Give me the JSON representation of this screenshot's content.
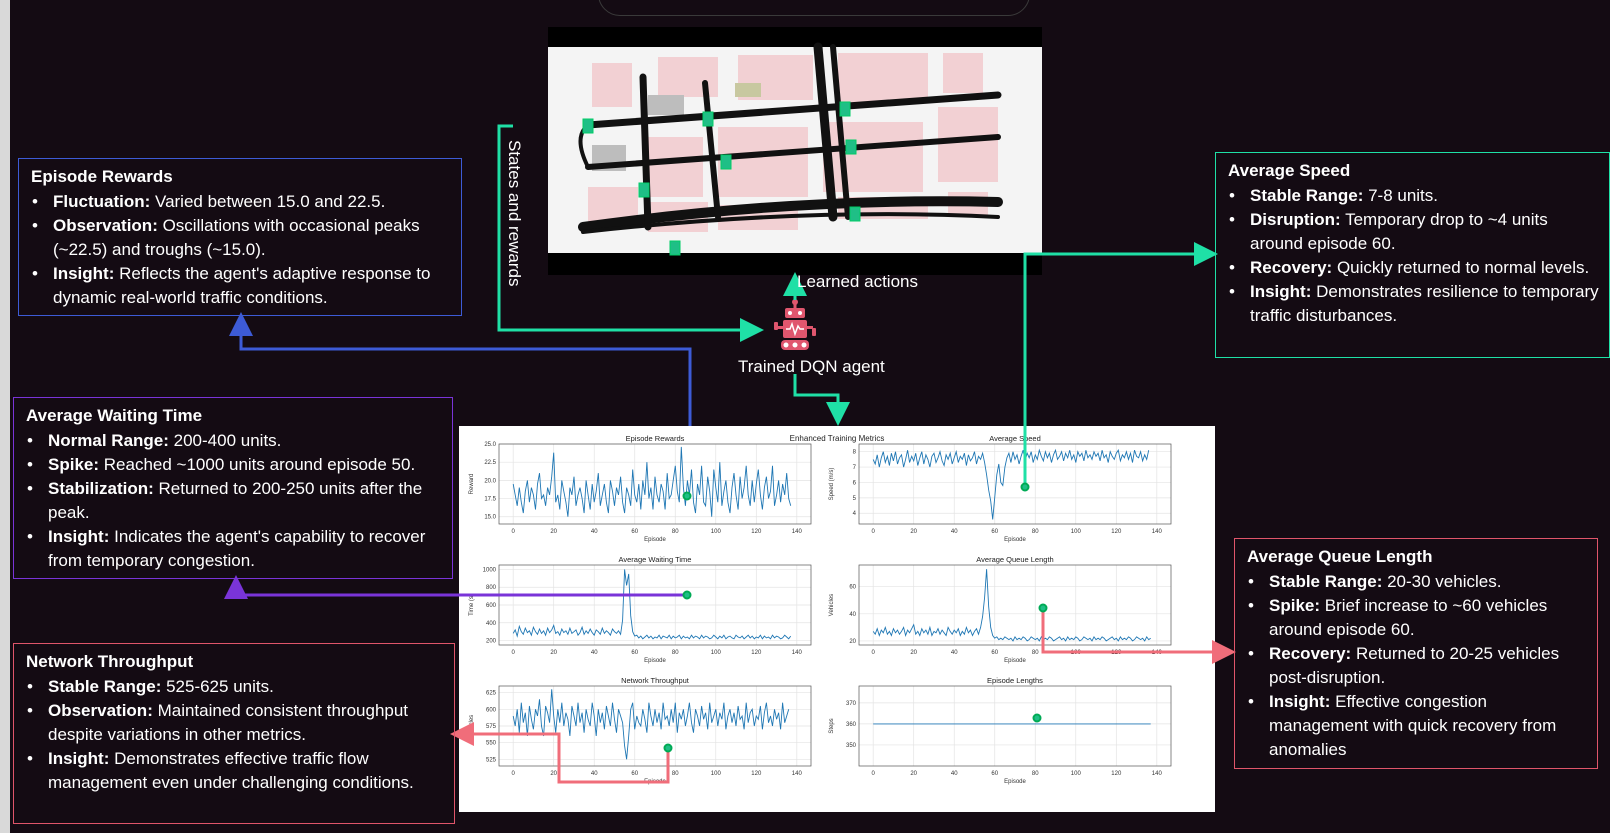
{
  "labels": {
    "states_rewards": "States and rewards",
    "learned_actions": "Learned  actions",
    "agent": "Trained  DQN agent"
  },
  "boxes": {
    "episode_rewards": {
      "title": "Episode Rewards",
      "items": [
        {
          "key": "Fluctuation:",
          "text": " Varied between 15.0 and 22.5."
        },
        {
          "key": "Observation:",
          "text": " Oscillations with occasional peaks (~22.5) and troughs (~15.0)."
        },
        {
          "key": "Insight:",
          "text": " Reflects the agent's adaptive response to dynamic real-world traffic conditions."
        }
      ]
    },
    "average_waiting_time": {
      "title": "Average Waiting Time",
      "items": [
        {
          "key": "Normal Range:",
          "text": " 200-400 units."
        },
        {
          "key": "Spike:",
          "text": " Reached ~1000 units around episode 50."
        },
        {
          "key": "Stabilization:",
          "text": " Returned to 200-250 units after the peak."
        },
        {
          "key": "Insight:",
          "text": " Indicates the agent's capability to recover from temporary congestion."
        }
      ]
    },
    "network_throughput": {
      "title": "Network Throughput",
      "items": [
        {
          "key": "Stable Range:",
          "text": " 525-625 units."
        },
        {
          "key": "Observation:",
          "text": " Maintained consistent throughput despite variations in other metrics."
        },
        {
          "key": "Insight:",
          "text": " Demonstrates effective traffic flow management even under challenging conditions."
        }
      ]
    },
    "average_speed": {
      "title": "Average Speed",
      "items": [
        {
          "key": "Stable Range:",
          "text": " 7-8 units."
        },
        {
          "key": "Disruption:",
          "text": " Temporary drop to ~4 units around episode 60."
        },
        {
          "key": "Recovery:",
          "text": " Quickly returned to normal levels."
        },
        {
          "key": "Insight:",
          "text": " Demonstrates resilience to temporary traffic disturbances."
        }
      ]
    },
    "average_queue_length": {
      "title": "Average Queue Length",
      "items": [
        {
          "key": "Stable Range:",
          "text": " 20-30 vehicles."
        },
        {
          "key": "Spike:",
          "text": " Brief increase to ~60 vehicles around episode 60."
        },
        {
          "key": "Recovery:",
          "text": " Returned to 20-25 vehicles post-disruption."
        },
        {
          "key": "Insight:",
          "text": " Effective congestion management with quick recovery from anomalies"
        }
      ]
    }
  },
  "colors": {
    "background": "#140b13",
    "rewards_border": "#3d5bd6",
    "waiting_border": "#7a34d8",
    "red_border": "#e0556a",
    "green": "#1fe0a6",
    "line": "#1f77b4"
  },
  "chart_data": {
    "type": "line",
    "title": "Enhanced Training Metrics",
    "panels": [
      {
        "title": "Episode Rewards",
        "xlabel": "Episode",
        "ylabel": "Reward",
        "ylim": [
          14,
          25
        ],
        "yticks": [
          "15.0",
          "17.5",
          "20.0",
          "22.5",
          "25.0"
        ],
        "ytick_values": [
          15,
          17.5,
          20,
          22.5,
          25
        ],
        "xticks": [
          "0",
          "20",
          "40",
          "60",
          "80",
          "100",
          "120",
          "140"
        ],
        "values": [
          19.5,
          18.0,
          16.5,
          19.0,
          17.0,
          15.5,
          18.5,
          20.0,
          17.0,
          19.0,
          18.0,
          16.0,
          19.5,
          21.0,
          17.5,
          18.0,
          16.5,
          19.0,
          18.0,
          20.5,
          23.8,
          17.0,
          18.0,
          16.0,
          20.0,
          18.5,
          17.0,
          15.0,
          19.0,
          18.0,
          20.5,
          16.5,
          18.0,
          19.0,
          17.5,
          15.5,
          20.0,
          18.0,
          16.0,
          19.5,
          17.0,
          18.5,
          21.0,
          16.5,
          18.0,
          19.5,
          17.0,
          15.5,
          20.0,
          18.5,
          16.5,
          19.0,
          18.0,
          20.5,
          17.0,
          15.5,
          19.0,
          18.0,
          16.5,
          21.5,
          18.0,
          17.0,
          19.5,
          16.0,
          20.0,
          18.0,
          22.5,
          17.5,
          19.0,
          16.0,
          20.5,
          18.0,
          17.0,
          19.5,
          18.5,
          16.0,
          21.0,
          17.5,
          18.0,
          20.0,
          22.0,
          18.5,
          17.0,
          24.6,
          19.0,
          16.5,
          20.0,
          18.0,
          21.5,
          17.0,
          15.5,
          19.5,
          18.0,
          22.0,
          17.0,
          16.5,
          20.5,
          18.5,
          15.0,
          21.5,
          19.0,
          17.0,
          22.5,
          16.5,
          18.5,
          20.0,
          17.0,
          15.5,
          19.0,
          21.0,
          18.0,
          16.0,
          20.5,
          17.5,
          19.0,
          22.0,
          18.0,
          16.5,
          20.0,
          17.0,
          19.5,
          21.5,
          18.0,
          16.0,
          19.0,
          20.5,
          17.5,
          18.5,
          22.0,
          16.5,
          18.0,
          20.0,
          17.0,
          19.5,
          18.0,
          21.0,
          17.5,
          16.5
        ]
      },
      {
        "title": "Average Speed",
        "xlabel": "Episode",
        "ylabel": "Speed (m/s)",
        "ylim": [
          3.3,
          8.5
        ],
        "yticks": [
          "4",
          "5",
          "6",
          "7",
          "8"
        ],
        "ytick_values": [
          4,
          5,
          6,
          7,
          8
        ],
        "xticks": [
          "0",
          "20",
          "40",
          "60",
          "80",
          "100",
          "120",
          "140"
        ],
        "values": [
          7.5,
          7.2,
          7.8,
          7.0,
          7.6,
          8.0,
          7.3,
          7.7,
          7.1,
          7.9,
          7.4,
          8.0,
          7.2,
          7.6,
          7.8,
          7.0,
          7.5,
          8.1,
          7.3,
          7.7,
          7.4,
          7.9,
          7.1,
          7.6,
          8.0,
          7.2,
          7.8,
          7.5,
          7.0,
          7.7,
          7.9,
          7.3,
          7.6,
          8.0,
          7.4,
          7.1,
          7.8,
          7.5,
          7.9,
          7.2,
          7.6,
          8.0,
          7.3,
          7.7,
          7.5,
          7.9,
          7.1,
          7.8,
          7.4,
          7.6,
          8.0,
          7.2,
          7.7,
          7.5,
          7.9,
          7.3,
          6.5,
          5.5,
          4.8,
          3.6,
          5.0,
          6.5,
          7.2,
          6.0,
          5.8,
          7.0,
          7.6,
          7.9,
          7.3,
          8.0,
          7.5,
          7.8,
          7.2,
          7.7,
          8.1,
          7.4,
          7.9,
          7.6,
          8.0,
          7.3,
          7.8,
          7.5,
          8.1,
          7.7,
          7.4,
          8.0,
          7.6,
          7.9,
          7.3,
          7.8,
          8.1,
          7.5,
          7.7,
          8.0,
          7.4,
          7.9,
          7.6,
          8.1,
          7.5,
          7.8,
          7.3,
          8.0,
          7.7,
          7.9,
          7.4,
          8.1,
          7.6,
          7.8,
          7.5,
          8.0,
          7.7,
          7.9,
          7.4,
          8.1,
          7.6,
          7.8,
          7.3,
          8.0,
          7.7,
          7.5,
          7.9,
          8.1,
          7.4,
          7.8,
          7.6,
          8.0,
          7.5,
          7.9,
          7.3,
          8.1,
          7.7,
          7.6,
          8.0,
          7.4,
          7.8,
          7.5,
          8.1
        ]
      },
      {
        "title": "Average Waiting Time",
        "xlabel": "Episode",
        "ylabel": "Time (s)",
        "ylim": [
          150,
          1050
        ],
        "yticks": [
          "200",
          "400",
          "600",
          "800",
          "1000"
        ],
        "ytick_values": [
          200,
          400,
          600,
          800,
          1000
        ],
        "xticks": [
          "0",
          "20",
          "40",
          "60",
          "80",
          "100",
          "120",
          "140"
        ],
        "values": [
          280,
          320,
          250,
          360,
          300,
          270,
          340,
          290,
          310,
          260,
          350,
          300,
          270,
          330,
          280,
          310,
          260,
          340,
          290,
          320,
          370,
          280,
          300,
          260,
          330,
          290,
          310,
          270,
          340,
          280,
          300,
          320,
          260,
          290,
          350,
          270,
          310,
          280,
          330,
          290,
          260,
          320,
          300,
          270,
          340,
          280,
          310,
          290,
          260,
          330,
          300,
          280,
          310,
          270,
          430,
          1000,
          820,
          950,
          480,
          300,
          250,
          260,
          230,
          250,
          220,
          240,
          260,
          230,
          250,
          220,
          240,
          230,
          260,
          220,
          250,
          240,
          230,
          260,
          220,
          250,
          230,
          240,
          260,
          220,
          250,
          230,
          240,
          220,
          260,
          230,
          250,
          240,
          220,
          260,
          230,
          250,
          240,
          220,
          230,
          260,
          240,
          220,
          250,
          230,
          260,
          220,
          240,
          250,
          230,
          220,
          260,
          240,
          230,
          250,
          220,
          240,
          260,
          230,
          250,
          220,
          240,
          230,
          260,
          220,
          250,
          230,
          240,
          220,
          260,
          230,
          250,
          240,
          220,
          230,
          260,
          240,
          220,
          250
        ]
      },
      {
        "title": "Average Queue Length",
        "xlabel": "Episode",
        "ylabel": "Vehicles",
        "ylim": [
          17,
          76
        ],
        "yticks": [
          "20",
          "40",
          "60"
        ],
        "ytick_values": [
          20,
          40,
          60
        ],
        "xticks": [
          "0",
          "20",
          "40",
          "60",
          "80",
          "100",
          "120",
          "140"
        ],
        "values": [
          27,
          25,
          29,
          24,
          28,
          26,
          30,
          25,
          27,
          24,
          29,
          26,
          28,
          25,
          27,
          30,
          24,
          28,
          26,
          29,
          32,
          25,
          27,
          24,
          29,
          26,
          28,
          25,
          30,
          24,
          27,
          26,
          29,
          25,
          28,
          26,
          24,
          30,
          27,
          25,
          28,
          26,
          29,
          24,
          27,
          25,
          30,
          26,
          28,
          24,
          27,
          29,
          25,
          30,
          38,
          52,
          73,
          45,
          30,
          24,
          22,
          23,
          21,
          22,
          21,
          23,
          22,
          21,
          22,
          20,
          23,
          21,
          22,
          21,
          23,
          22,
          20,
          21,
          23,
          22,
          21,
          22,
          20,
          23,
          21,
          22,
          21,
          23,
          22,
          20,
          21,
          22,
          23,
          21,
          22,
          20,
          23,
          21,
          22,
          21,
          23,
          22,
          20,
          21,
          23,
          22,
          21,
          22,
          20,
          23,
          21,
          22,
          21,
          23,
          22,
          20,
          21,
          22,
          23,
          21,
          22,
          20,
          23,
          21,
          22,
          21,
          23,
          22,
          20,
          21,
          23,
          22,
          21,
          22,
          20,
          23,
          21,
          22
        ]
      },
      {
        "title": "Network Throughput",
        "xlabel": "Episode",
        "ylabel": "Vehicles",
        "ylim": [
          515,
          635
        ],
        "yticks": [
          "525",
          "550",
          "575",
          "600",
          "625"
        ],
        "ytick_values": [
          525,
          550,
          575,
          600,
          625
        ],
        "xticks": [
          "0",
          "20",
          "40",
          "60",
          "80",
          "100",
          "120",
          "140"
        ],
        "values": [
          590,
          575,
          600,
          565,
          610,
          580,
          595,
          560,
          605,
          585,
          570,
          600,
          590,
          615,
          575,
          560,
          605,
          595,
          580,
          630,
          590,
          565,
          600,
          580,
          610,
          575,
          595,
          585,
          560,
          605,
          590,
          575,
          610,
          580,
          595,
          565,
          600,
          585,
          575,
          610,
          590,
          560,
          600,
          580,
          595,
          570,
          605,
          590,
          575,
          610,
          585,
          565,
          600,
          590,
          580,
          545,
          525,
          560,
          600,
          610,
          570,
          590,
          580,
          575,
          600,
          585,
          565,
          610,
          590,
          575,
          600,
          580,
          595,
          570,
          610,
          585,
          590,
          575,
          600,
          580,
          610,
          565,
          595,
          585,
          600,
          575,
          590,
          610,
          580,
          565,
          600,
          590,
          575,
          605,
          585,
          595,
          570,
          610,
          580,
          590,
          600,
          575,
          595,
          585,
          610,
          570,
          590,
          600,
          580,
          595,
          575,
          605,
          585,
          590,
          570,
          610,
          580,
          595,
          600,
          575,
          590,
          585,
          605,
          570,
          595,
          610,
          580,
          590,
          575,
          600,
          585,
          595,
          570,
          610,
          580,
          590,
          600
        ]
      },
      {
        "title": "Episode Lengths",
        "xlabel": "Episode",
        "ylabel": "Steps",
        "ylim": [
          340,
          378
        ],
        "yticks": [
          "350",
          "360",
          "370"
        ],
        "ytick_values": [
          350,
          360,
          370
        ],
        "xticks": [
          "0",
          "20",
          "40",
          "60",
          "80",
          "100",
          "120",
          "140"
        ],
        "values": [
          360,
          360
        ]
      }
    ]
  }
}
